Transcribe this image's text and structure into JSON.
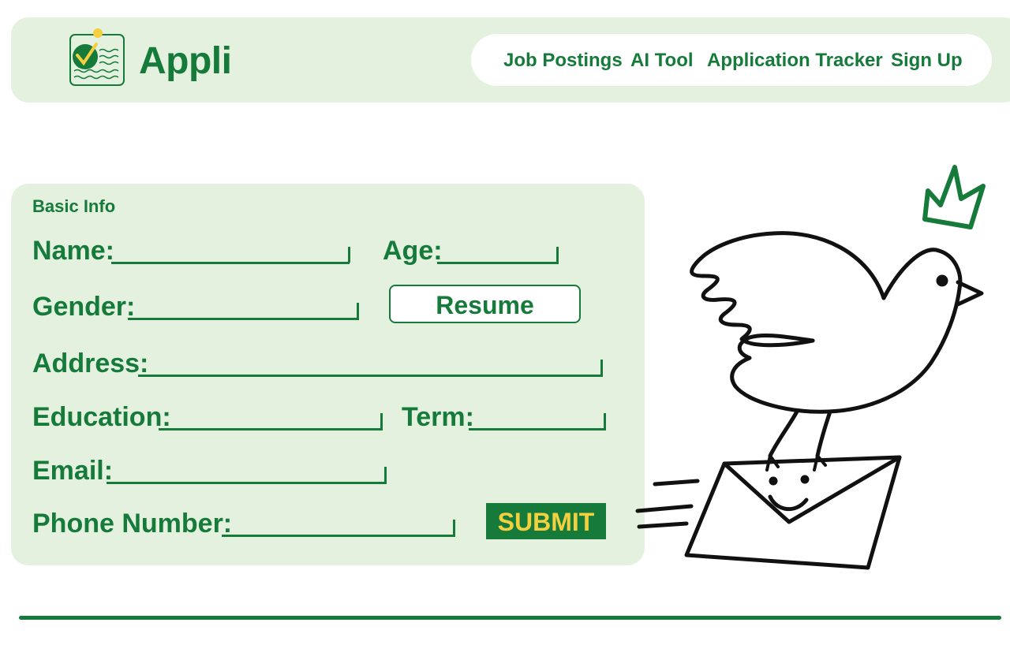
{
  "app": {
    "name": "Appli"
  },
  "nav": {
    "items": [
      "Job Postings",
      "AI Tool",
      "Application Tracker",
      "Sign Up"
    ]
  },
  "form": {
    "section_title": "Basic Info",
    "fields": {
      "name": "Name:",
      "age": "Age:",
      "gender": "Gender:",
      "address": "Address:",
      "education": "Education:",
      "term": "Term:",
      "email": "Email:",
      "phone": "Phone Number:"
    },
    "resume_label": "Resume",
    "submit_label": "SUBMIT"
  },
  "colors": {
    "brand_green": "#157a3a",
    "panel_bg": "#e4f1df",
    "submit_text": "#f4d03f"
  },
  "icons": [
    "logo-checkmark-document-icon",
    "crown-icon",
    "bird-with-envelope-illustration"
  ]
}
